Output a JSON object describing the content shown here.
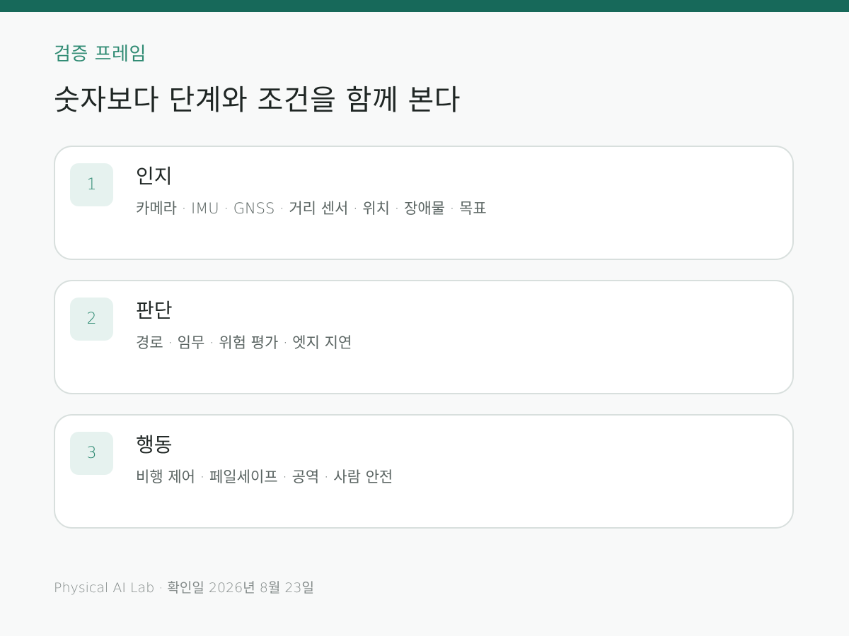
{
  "header": {
    "eyebrow": "검증 프레임",
    "title": "숫자보다 단계와 조건을 함께 본다"
  },
  "steps": [
    {
      "number": "1",
      "title": "인지",
      "description": "카메라 · IMU · GNSS · 거리 센서  ·  위치 · 장애물 · 목표"
    },
    {
      "number": "2",
      "title": "판단",
      "description": "경로 · 임무 · 위험 평가  ·  엣지 지연"
    },
    {
      "number": "3",
      "title": "행동",
      "description": "비행 제어 · 페일세이프  ·  공역 · 사람 안전"
    }
  ],
  "footer": {
    "text": "Physical AI Lab  ·  확인일 2026년 8월 23일"
  },
  "colors": {
    "accent": "#17695a",
    "accent_text": "#2e8a72",
    "badge_bg": "#e6f2ef"
  }
}
